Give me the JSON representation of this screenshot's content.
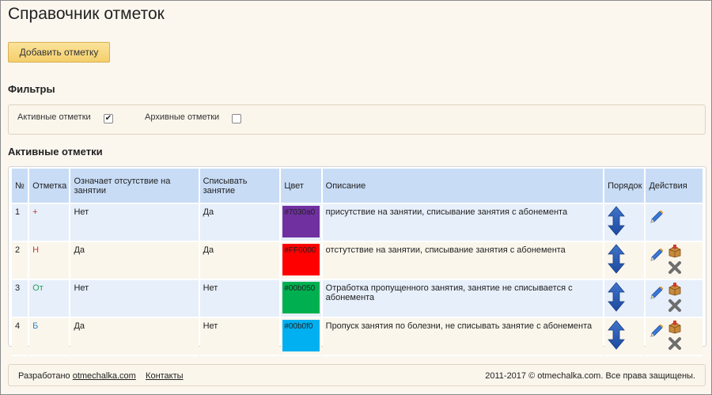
{
  "page": {
    "title": "Справочник отметок"
  },
  "toolbar": {
    "add_label": "Добавить отметку"
  },
  "filters": {
    "heading": "Фильтры",
    "active": {
      "label": "Активные отметки",
      "checked": true,
      "check_glyph": "✔"
    },
    "archive": {
      "label": "Архивные отметки",
      "checked": false
    }
  },
  "table": {
    "heading": "Активные отметки",
    "columns": {
      "num": "№",
      "mark": "Отметка",
      "absence": "Означает отсутствие на занятии",
      "charge": "Списывать занятие",
      "color": "Цвет",
      "desc": "Описание",
      "order": "Порядок",
      "actions": "Действия"
    },
    "rows": [
      {
        "num": "1",
        "mark": "+",
        "mark_color": "#c0392b",
        "absence": "Нет",
        "charge": "Да",
        "color": "#7030a0",
        "color_label": "#7030a0",
        "desc": "присутствие на занятии, списывание занятия с абонемента"
      },
      {
        "num": "2",
        "mark": "Н",
        "mark_color": "#e03030",
        "absence": "Да",
        "charge": "Да",
        "color": "#FF0000",
        "color_label": "#FF0000",
        "desc": "отстутствие на занятии, списывание занятия с абонемента"
      },
      {
        "num": "3",
        "mark": "От",
        "mark_color": "#27a05a",
        "absence": "Нет",
        "charge": "Нет",
        "color": "#00b050",
        "color_label": "#00b050",
        "desc": "Отработка пропущенного занятия, занятие не списывается с абонемента"
      },
      {
        "num": "4",
        "mark": "Б",
        "mark_color": "#2e86d4",
        "absence": "Да",
        "charge": "Нет",
        "color": "#00b0f0",
        "color_label": "#00b0f0",
        "desc": "Пропуск занятия по болезни, не списывать занятие с абонемента"
      }
    ],
    "icons": {
      "order": "up-down-arrow-icon",
      "edit": "pencil-icon",
      "archive": "box-icon",
      "delete": "delete-x-icon"
    }
  },
  "footer": {
    "dev_prefix": "Разработано",
    "dev_link": "otmechalka.com",
    "contacts": "Контакты",
    "copyright": "2011-2017 © otmechalka.com. Все права защищены."
  }
}
